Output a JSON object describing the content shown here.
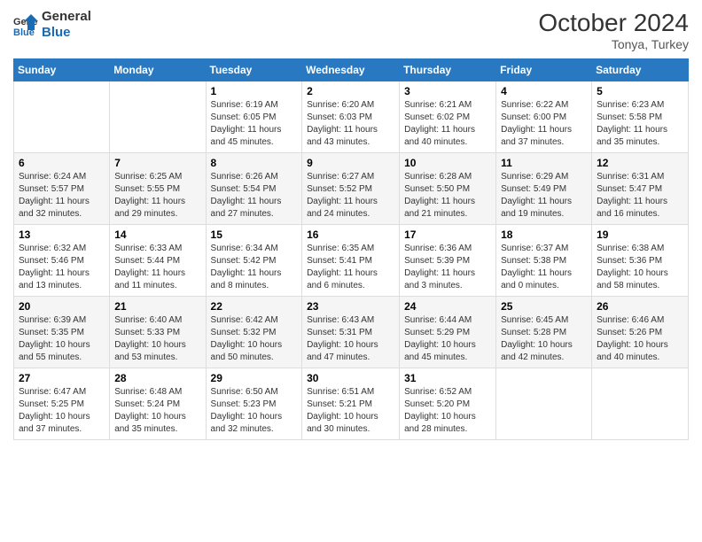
{
  "header": {
    "logo_line1": "General",
    "logo_line2": "Blue",
    "month": "October 2024",
    "location": "Tonya, Turkey"
  },
  "days_of_week": [
    "Sunday",
    "Monday",
    "Tuesday",
    "Wednesday",
    "Thursday",
    "Friday",
    "Saturday"
  ],
  "weeks": [
    [
      {
        "day": "",
        "sunrise": "",
        "sunset": "",
        "daylight": ""
      },
      {
        "day": "",
        "sunrise": "",
        "sunset": "",
        "daylight": ""
      },
      {
        "day": "1",
        "sunrise": "Sunrise: 6:19 AM",
        "sunset": "Sunset: 6:05 PM",
        "daylight": "Daylight: 11 hours and 45 minutes."
      },
      {
        "day": "2",
        "sunrise": "Sunrise: 6:20 AM",
        "sunset": "Sunset: 6:03 PM",
        "daylight": "Daylight: 11 hours and 43 minutes."
      },
      {
        "day": "3",
        "sunrise": "Sunrise: 6:21 AM",
        "sunset": "Sunset: 6:02 PM",
        "daylight": "Daylight: 11 hours and 40 minutes."
      },
      {
        "day": "4",
        "sunrise": "Sunrise: 6:22 AM",
        "sunset": "Sunset: 6:00 PM",
        "daylight": "Daylight: 11 hours and 37 minutes."
      },
      {
        "day": "5",
        "sunrise": "Sunrise: 6:23 AM",
        "sunset": "Sunset: 5:58 PM",
        "daylight": "Daylight: 11 hours and 35 minutes."
      }
    ],
    [
      {
        "day": "6",
        "sunrise": "Sunrise: 6:24 AM",
        "sunset": "Sunset: 5:57 PM",
        "daylight": "Daylight: 11 hours and 32 minutes."
      },
      {
        "day": "7",
        "sunrise": "Sunrise: 6:25 AM",
        "sunset": "Sunset: 5:55 PM",
        "daylight": "Daylight: 11 hours and 29 minutes."
      },
      {
        "day": "8",
        "sunrise": "Sunrise: 6:26 AM",
        "sunset": "Sunset: 5:54 PM",
        "daylight": "Daylight: 11 hours and 27 minutes."
      },
      {
        "day": "9",
        "sunrise": "Sunrise: 6:27 AM",
        "sunset": "Sunset: 5:52 PM",
        "daylight": "Daylight: 11 hours and 24 minutes."
      },
      {
        "day": "10",
        "sunrise": "Sunrise: 6:28 AM",
        "sunset": "Sunset: 5:50 PM",
        "daylight": "Daylight: 11 hours and 21 minutes."
      },
      {
        "day": "11",
        "sunrise": "Sunrise: 6:29 AM",
        "sunset": "Sunset: 5:49 PM",
        "daylight": "Daylight: 11 hours and 19 minutes."
      },
      {
        "day": "12",
        "sunrise": "Sunrise: 6:31 AM",
        "sunset": "Sunset: 5:47 PM",
        "daylight": "Daylight: 11 hours and 16 minutes."
      }
    ],
    [
      {
        "day": "13",
        "sunrise": "Sunrise: 6:32 AM",
        "sunset": "Sunset: 5:46 PM",
        "daylight": "Daylight: 11 hours and 13 minutes."
      },
      {
        "day": "14",
        "sunrise": "Sunrise: 6:33 AM",
        "sunset": "Sunset: 5:44 PM",
        "daylight": "Daylight: 11 hours and 11 minutes."
      },
      {
        "day": "15",
        "sunrise": "Sunrise: 6:34 AM",
        "sunset": "Sunset: 5:42 PM",
        "daylight": "Daylight: 11 hours and 8 minutes."
      },
      {
        "day": "16",
        "sunrise": "Sunrise: 6:35 AM",
        "sunset": "Sunset: 5:41 PM",
        "daylight": "Daylight: 11 hours and 6 minutes."
      },
      {
        "day": "17",
        "sunrise": "Sunrise: 6:36 AM",
        "sunset": "Sunset: 5:39 PM",
        "daylight": "Daylight: 11 hours and 3 minutes."
      },
      {
        "day": "18",
        "sunrise": "Sunrise: 6:37 AM",
        "sunset": "Sunset: 5:38 PM",
        "daylight": "Daylight: 11 hours and 0 minutes."
      },
      {
        "day": "19",
        "sunrise": "Sunrise: 6:38 AM",
        "sunset": "Sunset: 5:36 PM",
        "daylight": "Daylight: 10 hours and 58 minutes."
      }
    ],
    [
      {
        "day": "20",
        "sunrise": "Sunrise: 6:39 AM",
        "sunset": "Sunset: 5:35 PM",
        "daylight": "Daylight: 10 hours and 55 minutes."
      },
      {
        "day": "21",
        "sunrise": "Sunrise: 6:40 AM",
        "sunset": "Sunset: 5:33 PM",
        "daylight": "Daylight: 10 hours and 53 minutes."
      },
      {
        "day": "22",
        "sunrise": "Sunrise: 6:42 AM",
        "sunset": "Sunset: 5:32 PM",
        "daylight": "Daylight: 10 hours and 50 minutes."
      },
      {
        "day": "23",
        "sunrise": "Sunrise: 6:43 AM",
        "sunset": "Sunset: 5:31 PM",
        "daylight": "Daylight: 10 hours and 47 minutes."
      },
      {
        "day": "24",
        "sunrise": "Sunrise: 6:44 AM",
        "sunset": "Sunset: 5:29 PM",
        "daylight": "Daylight: 10 hours and 45 minutes."
      },
      {
        "day": "25",
        "sunrise": "Sunrise: 6:45 AM",
        "sunset": "Sunset: 5:28 PM",
        "daylight": "Daylight: 10 hours and 42 minutes."
      },
      {
        "day": "26",
        "sunrise": "Sunrise: 6:46 AM",
        "sunset": "Sunset: 5:26 PM",
        "daylight": "Daylight: 10 hours and 40 minutes."
      }
    ],
    [
      {
        "day": "27",
        "sunrise": "Sunrise: 6:47 AM",
        "sunset": "Sunset: 5:25 PM",
        "daylight": "Daylight: 10 hours and 37 minutes."
      },
      {
        "day": "28",
        "sunrise": "Sunrise: 6:48 AM",
        "sunset": "Sunset: 5:24 PM",
        "daylight": "Daylight: 10 hours and 35 minutes."
      },
      {
        "day": "29",
        "sunrise": "Sunrise: 6:50 AM",
        "sunset": "Sunset: 5:23 PM",
        "daylight": "Daylight: 10 hours and 32 minutes."
      },
      {
        "day": "30",
        "sunrise": "Sunrise: 6:51 AM",
        "sunset": "Sunset: 5:21 PM",
        "daylight": "Daylight: 10 hours and 30 minutes."
      },
      {
        "day": "31",
        "sunrise": "Sunrise: 6:52 AM",
        "sunset": "Sunset: 5:20 PM",
        "daylight": "Daylight: 10 hours and 28 minutes."
      },
      {
        "day": "",
        "sunrise": "",
        "sunset": "",
        "daylight": ""
      },
      {
        "day": "",
        "sunrise": "",
        "sunset": "",
        "daylight": ""
      }
    ]
  ]
}
